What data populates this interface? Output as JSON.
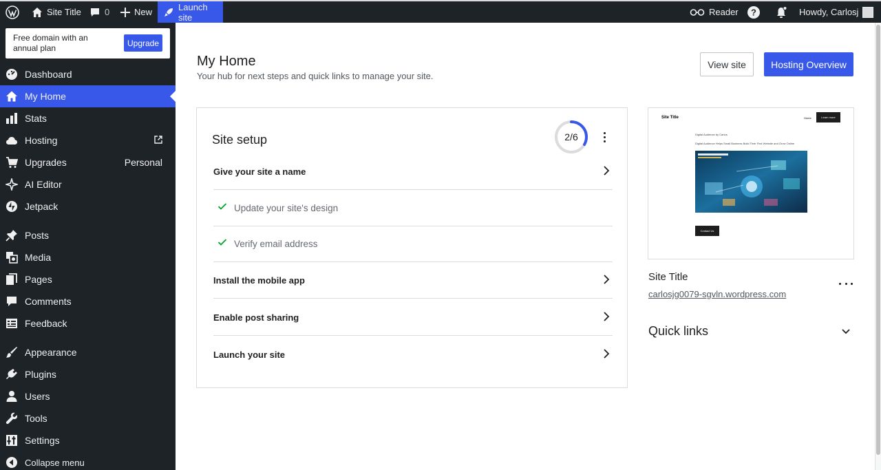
{
  "adminbar": {
    "site_title": "Site Title",
    "comments_count": "0",
    "new_label": "New",
    "launch_label": "Launch site",
    "reader_label": "Reader",
    "howdy": "Howdy, Carlosj"
  },
  "sidebar": {
    "promo_text": "Free domain with an annual plan",
    "promo_button": "Upgrade",
    "items": [
      {
        "label": "Dashboard",
        "icon": "dashboard-icon"
      },
      {
        "label": "My Home",
        "icon": "home-icon"
      },
      {
        "label": "Stats",
        "icon": "stats-icon"
      },
      {
        "label": "Hosting",
        "icon": "cloud-icon"
      },
      {
        "label": "Upgrades",
        "icon": "cart-icon",
        "extra": "Personal"
      },
      {
        "label": "AI Editor",
        "icon": "sparkle-icon"
      },
      {
        "label": "Jetpack",
        "icon": "jetpack-icon"
      },
      {
        "label": "Posts",
        "icon": "pin-icon"
      },
      {
        "label": "Media",
        "icon": "media-icon"
      },
      {
        "label": "Pages",
        "icon": "pages-icon"
      },
      {
        "label": "Comments",
        "icon": "comment-icon"
      },
      {
        "label": "Feedback",
        "icon": "feedback-icon"
      },
      {
        "label": "Appearance",
        "icon": "brush-icon"
      },
      {
        "label": "Plugins",
        "icon": "plug-icon"
      },
      {
        "label": "Users",
        "icon": "user-icon"
      },
      {
        "label": "Tools",
        "icon": "wrench-icon"
      },
      {
        "label": "Settings",
        "icon": "settings-icon"
      },
      {
        "label": "Collapse menu",
        "icon": "collapse-icon"
      }
    ]
  },
  "main": {
    "title": "My Home",
    "subtitle": "Your hub for next steps and quick links to manage your site.",
    "view_site": "View site",
    "hosting_overview": "Hosting Overview"
  },
  "setup": {
    "title": "Site setup",
    "progress_label": "2/6",
    "progress_fraction": 0.3333,
    "tasks": [
      {
        "label": "Give your site a name",
        "done": false
      },
      {
        "label": "Update your site's design",
        "done": true
      },
      {
        "label": "Verify email address",
        "done": true
      },
      {
        "label": "Install the mobile app",
        "done": false
      },
      {
        "label": "Enable post sharing",
        "done": false
      },
      {
        "label": "Launch your site",
        "done": false
      }
    ]
  },
  "preview": {
    "site_title": "Site Title",
    "nav_home": "Home",
    "learn_more": "Learn more",
    "line1": "Digital Audience by Carlos",
    "line2": "Digital Audience Helps Small Business Build Their First Website and Grow Online",
    "contact": "Contact Us"
  },
  "site": {
    "name": "Site Title",
    "url": "carlosjg0079-sgvln.wordpress.com"
  },
  "quick_links": "Quick links",
  "colors": {
    "accent": "#3858e9",
    "sidebar_bg": "#1d2327",
    "check_green": "#00a32a"
  }
}
